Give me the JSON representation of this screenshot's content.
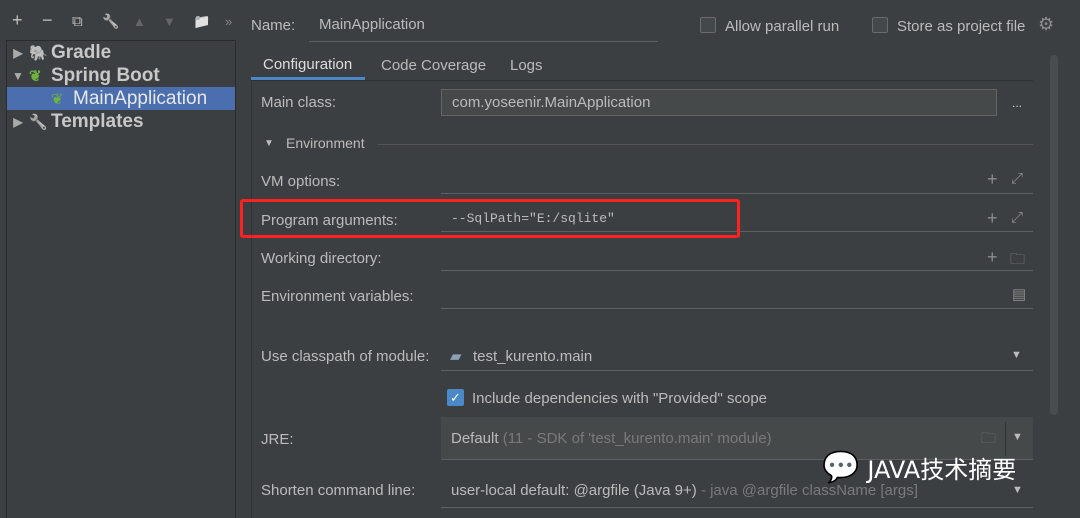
{
  "toolbar": {
    "add": "+",
    "remove": "−",
    "copy": "⧉",
    "wrench": "🔧",
    "up": "▲",
    "down": "▼",
    "folder": "📁",
    "more": "»"
  },
  "tree": [
    {
      "label": "Gradle",
      "expanded": false
    },
    {
      "label": "Spring Boot",
      "expanded": true
    },
    {
      "label": "MainApplication",
      "selected": true
    },
    {
      "label": "Templates",
      "expanded": false
    }
  ],
  "header": {
    "name_label": "Name:",
    "name_value": "MainApplication",
    "allow_parallel": "Allow parallel run",
    "store_project": "Store as project file"
  },
  "tabs": [
    "Configuration",
    "Code Coverage",
    "Logs"
  ],
  "form": {
    "main_class_label": "Main class:",
    "main_class_value": "com.yoseenir.MainApplication",
    "browse": "...",
    "environment": "Environment",
    "vm_label": "VM options:",
    "prog_label": "Program arguments:",
    "prog_value": "--SqlPath=\"E:/sqlite\"",
    "workdir_label": "Working directory:",
    "env_label": "Environment variables:",
    "classpath_label": "Use classpath of module:",
    "classpath_value": "test_kurento.main",
    "include_deps": "Include dependencies with \"Provided\" scope",
    "include_deps_checked": true,
    "jre_label": "JRE:",
    "jre_value": "Default",
    "jre_hint": "(11 - SDK of 'test_kurento.main' module)",
    "shorten_label": "Shorten command line:",
    "shorten_value": "user-local default: @argfile (Java 9+)",
    "shorten_hint": "- java @argfile className [args]"
  },
  "watermark": "JAVA技术摘要",
  "colors": {
    "selection": "#4b6eaf",
    "highlight": "#ff2020",
    "spring": "#6db33f",
    "checkbox": "#4a88c7"
  }
}
